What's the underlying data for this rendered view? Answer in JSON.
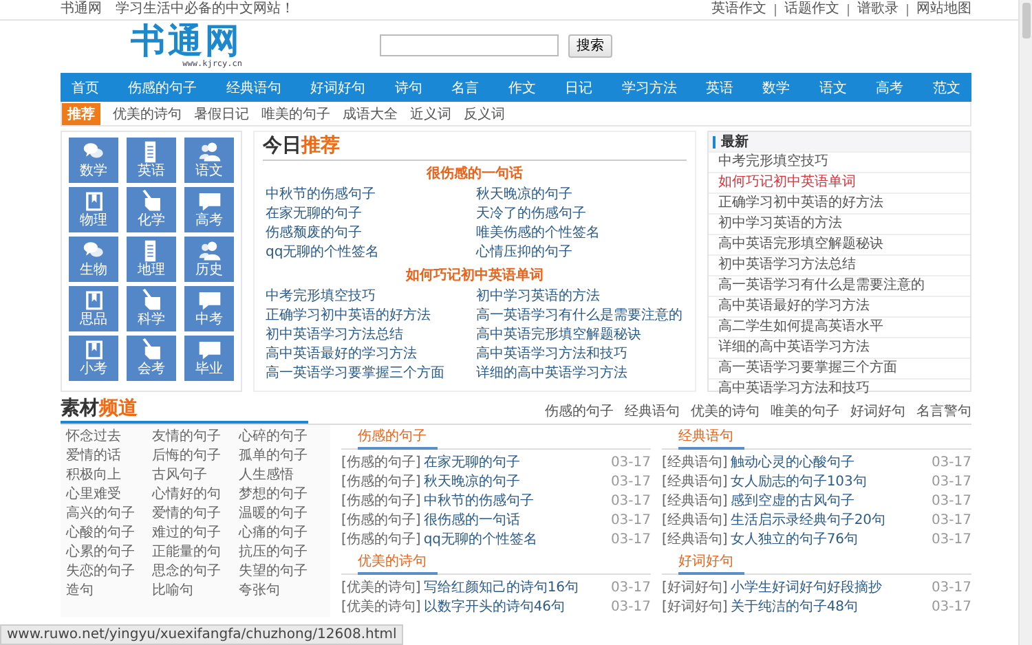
{
  "top_bar": {
    "site": "书通网",
    "slogan": "学习生活中必备的中文网站！",
    "links": [
      "英语作文",
      "话题作文",
      "谱歌录",
      "网站地图"
    ]
  },
  "header": {
    "logo": "书通网",
    "logo_url": "www.kjrcy.cn",
    "search_button": "搜索"
  },
  "nav": [
    "首页",
    "伤感的句子",
    "经典语句",
    "好词好句",
    "诗句",
    "名言",
    "作文",
    "日记",
    "学习方法",
    "英语",
    "数学",
    "语文",
    "高考",
    "范文"
  ],
  "recommend": {
    "badge": "推荐",
    "links": [
      "优美的诗句",
      "暑假日记",
      "唯美的句子",
      "成语大全",
      "近义词",
      "反义词"
    ]
  },
  "subjects": [
    {
      "label": "数学",
      "kind": "chat"
    },
    {
      "label": "英语",
      "kind": "doc"
    },
    {
      "label": "语文",
      "kind": "people"
    },
    {
      "label": "物理",
      "kind": "book"
    },
    {
      "label": "化学",
      "kind": "pencil"
    },
    {
      "label": "高考",
      "kind": "speech"
    },
    {
      "label": "生物",
      "kind": "chat"
    },
    {
      "label": "地理",
      "kind": "doc"
    },
    {
      "label": "历史",
      "kind": "people"
    },
    {
      "label": "思品",
      "kind": "book"
    },
    {
      "label": "科学",
      "kind": "pencil"
    },
    {
      "label": "中考",
      "kind": "speech"
    },
    {
      "label": "小考",
      "kind": "book"
    },
    {
      "label": "会考",
      "kind": "pencil"
    },
    {
      "label": "毕业",
      "kind": "speech"
    }
  ],
  "today": {
    "title_lead": "今日",
    "title_accent": "推荐",
    "groups": [
      {
        "heading": "很伤感的一句话",
        "links": [
          "中秋节的伤感句子",
          "秋天晚凉的句子",
          "在家无聊的句子",
          "天冷了的伤感句子",
          "伤感颓废的句子",
          "唯美伤感的个性签名",
          "qq无聊的个性签名",
          "心情压抑的句子"
        ]
      },
      {
        "heading": "如何巧记初中英语单词",
        "links": [
          "中考完形填空技巧",
          "初中学习英语的方法",
          "正确学习初中英语的好方法",
          "高一英语学习有什么是需要注意的",
          "初中英语学习方法总结",
          "高中英语完形填空解题秘诀",
          "高中英语最好的学习方法",
          "高中英语学习方法和技巧",
          "高一英语学习要掌握三个方面",
          "详细的高中英语学习方法"
        ]
      }
    ]
  },
  "latest": {
    "title": "最新",
    "items": [
      {
        "text": "中考完形填空技巧",
        "highlighted": false
      },
      {
        "text": "如何巧记初中英语单词",
        "highlighted": true
      },
      {
        "text": "正确学习初中英语的好方法",
        "highlighted": false
      },
      {
        "text": "初中学习英语的方法",
        "highlighted": false
      },
      {
        "text": "高中英语完形填空解题秘诀",
        "highlighted": false
      },
      {
        "text": "初中英语学习方法总结",
        "highlighted": false
      },
      {
        "text": "高一英语学习有什么是需要注意的",
        "highlighted": false
      },
      {
        "text": "高中英语最好的学习方法",
        "highlighted": false
      },
      {
        "text": "高二学生如何提高英语水平",
        "highlighted": false
      },
      {
        "text": "详细的高中英语学习方法",
        "highlighted": false
      },
      {
        "text": "高一英语学习要掌握三个方面",
        "highlighted": false
      },
      {
        "text": "高中英语学习方法和技巧",
        "highlighted": false
      }
    ]
  },
  "materials": {
    "title_lead": "素材",
    "title_accent": "频道",
    "tabs": [
      "伤感的句子",
      "经典语句",
      "优美的诗句",
      "唯美的句子",
      "好词好句",
      "名言警句"
    ],
    "tags": [
      "怀念过去",
      "友情的句子",
      "心碎的句子",
      "爱情的话",
      "后悔的句子",
      "孤单的句子",
      "积极向上",
      "古风句子",
      "人生感悟",
      "心里难受",
      "心情好的句",
      "梦想的句子",
      "高兴的句子",
      "爱情的句子",
      "温暖的句子",
      "心酸的句子",
      "难过的句子",
      "心痛的句子",
      "心累的句子",
      "正能量的句",
      "抗压的句子",
      "失恋的句子",
      "思念的句子",
      "失望的句子",
      "造句",
      "比喻句",
      "夸张句"
    ],
    "columns": [
      [
        {
          "heading": "伤感的句子",
          "items": [
            {
              "category": "[伤感的句子]",
              "title": "在家无聊的句子",
              "date": "03-17"
            },
            {
              "category": "[伤感的句子]",
              "title": "秋天晚凉的句子",
              "date": "03-17"
            },
            {
              "category": "[伤感的句子]",
              "title": "中秋节的伤感句子",
              "date": "03-17"
            },
            {
              "category": "[伤感的句子]",
              "title": "很伤感的一句话",
              "date": "03-17"
            },
            {
              "category": "[伤感的句子]",
              "title": "qq无聊的个性签名",
              "date": "03-17"
            }
          ]
        },
        {
          "heading": "优美的诗句",
          "items": [
            {
              "category": "[优美的诗句]",
              "title": "写给红颜知己的诗句16句",
              "date": "03-17"
            },
            {
              "category": "[优美的诗句]",
              "title": "以数字开头的诗句46句",
              "date": "03-17"
            }
          ]
        }
      ],
      [
        {
          "heading": "经典语句",
          "items": [
            {
              "category": "[经典语句]",
              "title": "触动心灵的心酸句子",
              "date": "03-17"
            },
            {
              "category": "[经典语句]",
              "title": "女人励志的句子103句",
              "date": "03-17"
            },
            {
              "category": "[经典语句]",
              "title": "感到空虚的古风句子",
              "date": "03-17"
            },
            {
              "category": "[经典语句]",
              "title": "生活启示录经典句子20句",
              "date": "03-17"
            },
            {
              "category": "[经典语句]",
              "title": "女人独立的句子76句",
              "date": "03-17"
            }
          ]
        },
        {
          "heading": "好词好句",
          "items": [
            {
              "category": "[好词好句]",
              "title": "小学生好词好句好段摘抄",
              "date": "03-17"
            },
            {
              "category": "[好词好句]",
              "title": "关于纯洁的句子48句",
              "date": "03-17"
            }
          ]
        }
      ]
    ]
  },
  "status_bar": {
    "url": "www.ruwo.net/yingyu/xuexifangfa/chuzhong/12608.html"
  }
}
